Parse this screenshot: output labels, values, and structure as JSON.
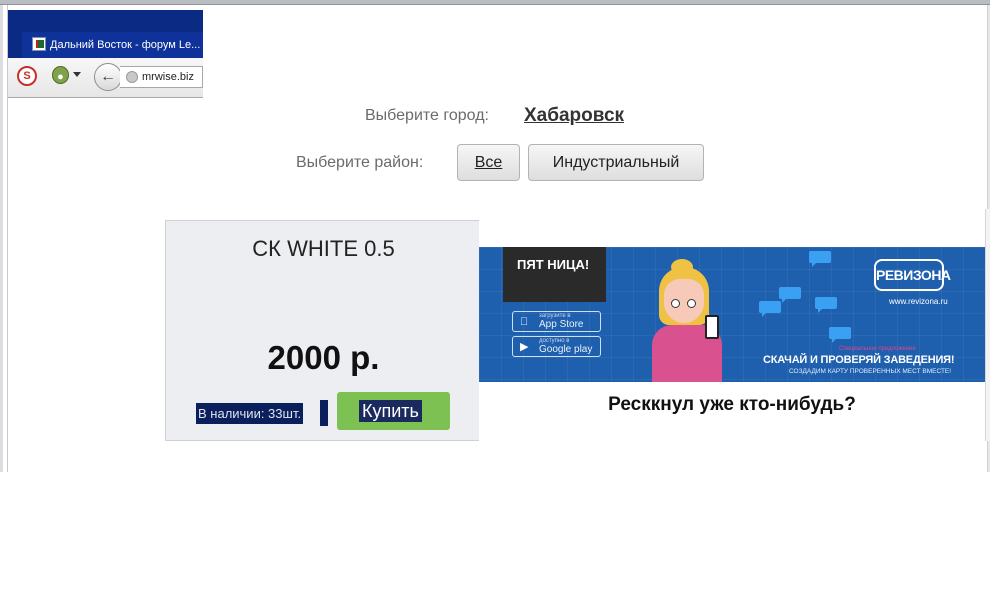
{
  "browser": {
    "tab_title": "Дальний Восток - форум Le...",
    "url": "mrwise.biz",
    "icons": [
      "stop-icon",
      "onion-icon",
      "back-arrow-icon",
      "globe-icon",
      "favicon-icon"
    ]
  },
  "selector": {
    "city_label": "Выберите город:",
    "city_value": "Хабаровск",
    "district_label": "Выберите район:",
    "district_buttons": [
      "Все",
      "Индустриальный"
    ]
  },
  "product": {
    "title": "СК WHITE 0.5",
    "price": "2000 р.",
    "stock": "В наличии: 33шт.",
    "buy_label": "Купить",
    "buy_color": "#7cc151"
  },
  "banner": {
    "logo": "ПЯТ НИЦА!",
    "app_store_small": "загрузите в",
    "app_store": "App Store",
    "google_small": "доступно в",
    "google_play": "Google play",
    "brand": "РЕВИЗОНА",
    "brand_url": "www.revizona.ru",
    "pink_text": "Специальное предложение",
    "slogan": "СКАЧАЙ И ПРОВЕРЯЙ ЗАВЕДЕНИЯ!",
    "sub_slogan": "СОЗДАДИМ КАРТУ ПРОВЕРЕННЫХ МЕСТ ВМЕСТЕ!",
    "caption": "Ресккнул уже кто-нибудь?",
    "bg_color": "#1e5fae"
  }
}
